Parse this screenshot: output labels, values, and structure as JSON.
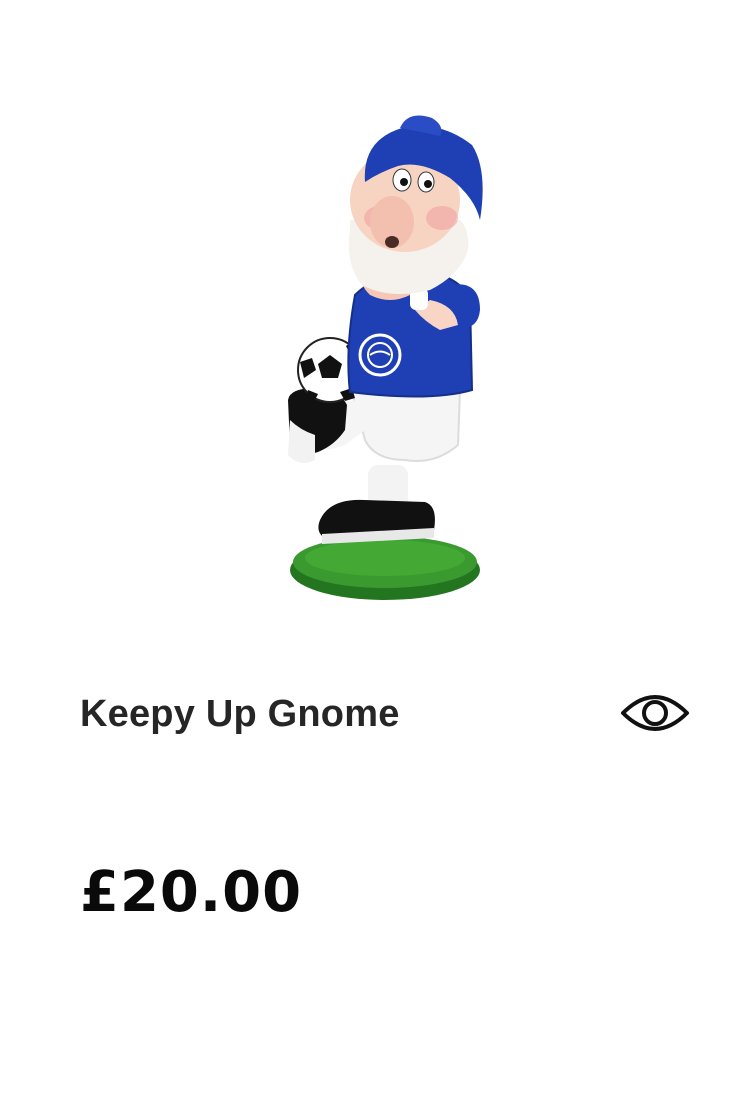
{
  "product": {
    "name": "Keepy Up Gnome",
    "price": "£20.00",
    "image_icon": "gnome-figurine-image",
    "quick_view_icon": "eye-icon"
  },
  "colors": {
    "title": "#262626",
    "price": "#0a0a0a",
    "shirt_blue": "#1f3fb5",
    "grass_green": "#2e8b2e"
  }
}
